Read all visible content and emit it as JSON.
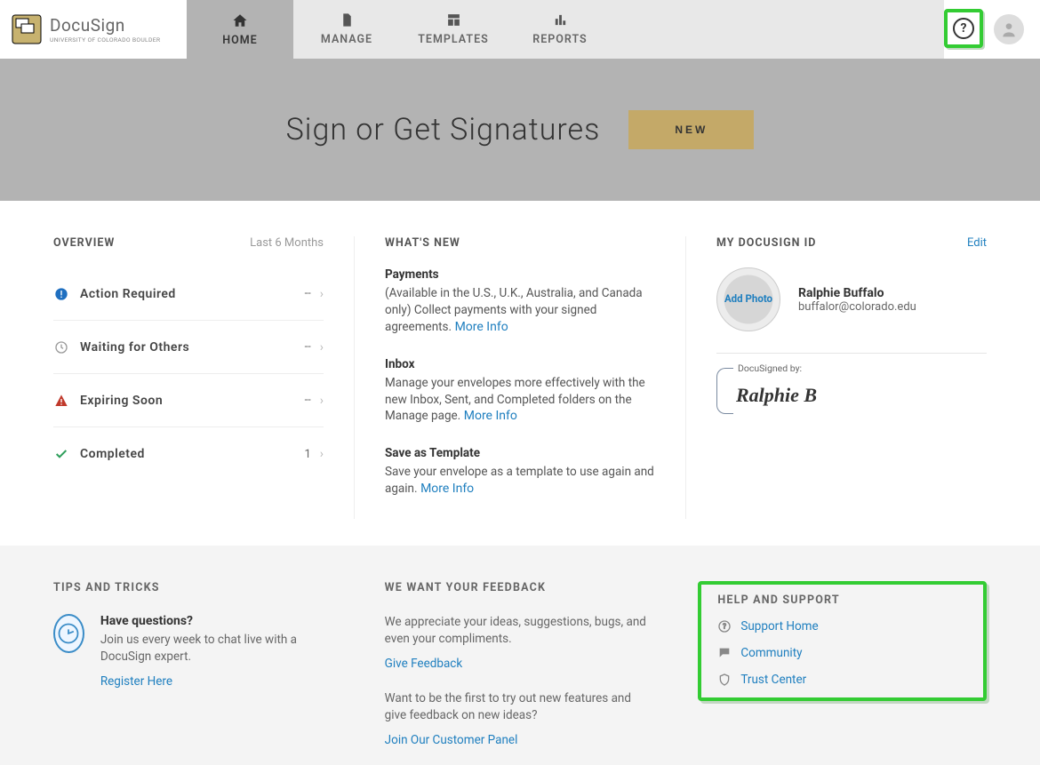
{
  "brand": {
    "app_name": "DocuSign",
    "org_line": "UNIVERSITY OF COLORADO BOULDER"
  },
  "nav": {
    "items": [
      {
        "label": "HOME",
        "active": true
      },
      {
        "label": "MANAGE",
        "active": false
      },
      {
        "label": "TEMPLATES",
        "active": false
      },
      {
        "label": "REPORTS",
        "active": false
      }
    ]
  },
  "hero": {
    "title": "Sign or Get Signatures",
    "new_btn": "NEW"
  },
  "overview": {
    "title": "OVERVIEW",
    "range": "Last 6 Months",
    "rows": [
      {
        "label": "Action Required",
        "count": "--"
      },
      {
        "label": "Waiting for Others",
        "count": "--"
      },
      {
        "label": "Expiring Soon",
        "count": "--"
      },
      {
        "label": "Completed",
        "count": "1"
      }
    ]
  },
  "whatsnew": {
    "title": "WHAT'S NEW",
    "items": [
      {
        "heading": "Payments",
        "text": "(Available in the U.S., U.K., Australia, and Canada only) Collect payments with your signed agreements.",
        "more": "More Info"
      },
      {
        "heading": "Inbox",
        "text": "Manage your envelopes more effectively with the new Inbox, Sent, and Completed folders on the Manage page.",
        "more": "More Info"
      },
      {
        "heading": "Save as Template",
        "text": "Save your envelope as a template to use again and again.",
        "more": "More Info"
      }
    ]
  },
  "idcard": {
    "title": "MY DOCUSIGN ID",
    "edit": "Edit",
    "add_photo": "Add Photo",
    "name": "Ralphie Buffalo",
    "email": "buffalor@colorado.edu",
    "signed_by_label": "DocuSigned by:",
    "signature": "Ralphie B"
  },
  "tips": {
    "title": "TIPS AND TRICKS",
    "heading": "Have questions?",
    "text": "Join us every week to chat live with a DocuSign expert.",
    "register": "Register Here"
  },
  "feedback": {
    "title": "WE WANT YOUR FEEDBACK",
    "text1": "We appreciate your ideas, suggestions, bugs, and even your compliments.",
    "link1": "Give Feedback",
    "text2": "Want to be the first to try out new features and give feedback on new ideas?",
    "link2": "Join Our Customer Panel"
  },
  "help": {
    "title": "HELP AND SUPPORT",
    "links": [
      {
        "label": "Support Home"
      },
      {
        "label": "Community"
      },
      {
        "label": "Trust Center"
      }
    ]
  }
}
